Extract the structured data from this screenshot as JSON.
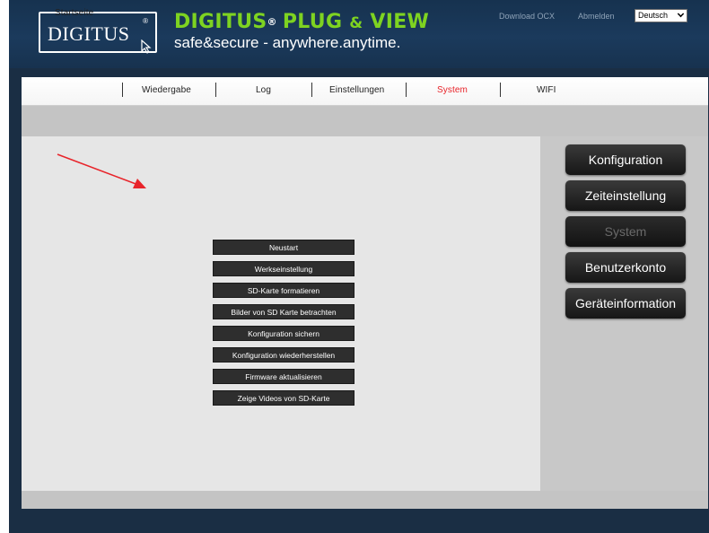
{
  "header": {
    "logo_text": "DIGITUS",
    "logo_reg": "®",
    "brand_title_main": "DIGITUS",
    "brand_title_tm": "®",
    "brand_title_rest1": "PLUG ",
    "brand_title_amp": "&",
    "brand_title_rest2": " VIEW",
    "brand_subtitle": "safe&secure - anywhere.anytime.",
    "download_ocx": "Download OCX",
    "logout": "Abmelden",
    "language": "Deutsch"
  },
  "nav": {
    "tabs": [
      "Startseite",
      "Wiedergabe",
      "Log",
      "Einstellungen",
      "System",
      "WIFI"
    ],
    "active": "System"
  },
  "sidebar": {
    "items": [
      "Konfiguration",
      "Zeiteinstellung",
      "System",
      "Benutzerkonto",
      "Geräteinformation"
    ],
    "selected": "System"
  },
  "actions": [
    "Neustart",
    "Werkseinstellung",
    "SD-Karte formatieren",
    "Bilder von SD Karte betrachten",
    "Konfiguration sichern",
    "Konfiguration wiederherstellen",
    "Firmware aktualisieren",
    "Zeige Videos von SD-Karte"
  ],
  "colors": {
    "header_bg": "#1b3a5c",
    "active_tab": "#e8242a",
    "annotation_arrow": "#e8242a",
    "button_bg": "#2e2e2e"
  },
  "icons": {
    "language_dropdown": "chevron-down-icon",
    "logo_cursor": "cursor-icon",
    "annotation": "red-arrow-icon"
  }
}
